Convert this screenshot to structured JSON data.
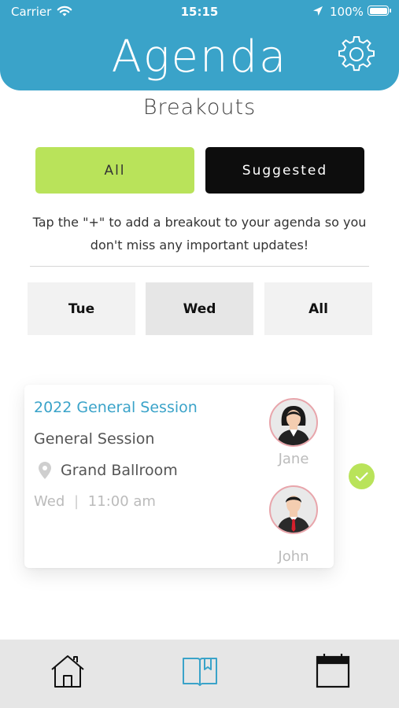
{
  "status_bar": {
    "carrier": "Carrier",
    "time": "15:15",
    "battery": "100%"
  },
  "header": {
    "title": "Agenda",
    "settings_icon": "gear-icon",
    "color": "#3aa3c9"
  },
  "page": {
    "subtitle": "Breakouts"
  },
  "filter": {
    "all_label": "All",
    "suggested_label": "Suggested",
    "selected": "All",
    "colors": {
      "active": "#b9e35a",
      "inactive": "#0d0d0d"
    }
  },
  "hint": "Tap the \"+\" to add a breakout to your agenda so you don't miss any important updates!",
  "days": [
    {
      "label": "Tue",
      "selected": false
    },
    {
      "label": "Wed",
      "selected": true
    },
    {
      "label": "All",
      "selected": false
    }
  ],
  "sessions": [
    {
      "title": "2022 General Session",
      "type": "General Session",
      "location": "Grand Ballroom",
      "day": "Wed",
      "time": "11:00 am",
      "added": true,
      "speakers": [
        {
          "name": "Jane",
          "icon": "avatar-female"
        },
        {
          "name": "John",
          "icon": "avatar-male"
        }
      ]
    }
  ],
  "tabbar": {
    "items": [
      {
        "icon": "home-icon",
        "active": false
      },
      {
        "icon": "book-icon",
        "active": true
      },
      {
        "icon": "calendar-icon",
        "active": false
      }
    ],
    "active_color": "#3aa3c9"
  }
}
